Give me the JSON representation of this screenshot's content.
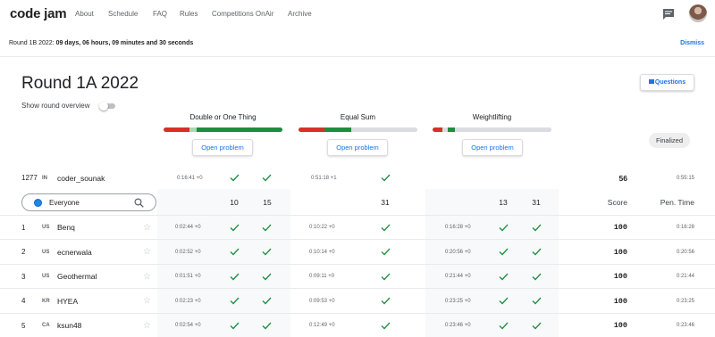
{
  "nav": {
    "logo": "code jam",
    "links": [
      "About",
      "Schedule",
      "FAQ",
      "Rules",
      "Competitions OnAir",
      "Archive"
    ],
    "icons": [
      "chat-icon",
      "avatar"
    ]
  },
  "banner": {
    "label": "Round 1B 2022:",
    "time": "09 days, 06 hours, 09 minutes and 30 seconds",
    "dismiss": "Dismiss"
  },
  "header": {
    "title": "Round 1A 2022",
    "questions_label": "Questions",
    "overview_label": "Show round overview",
    "overview_on": false
  },
  "problems": [
    {
      "name": "Double or One Thing",
      "open_label": "Open problem",
      "bar": [
        {
          "frac": 0.22,
          "color": "#d93025"
        },
        {
          "frac": 0.06,
          "color": "#a8dab5"
        },
        {
          "frac": 0.72,
          "color": "#1e8e3e"
        }
      ]
    },
    {
      "name": "Equal Sum",
      "open_label": "Open problem",
      "bar": [
        {
          "frac": 0.22,
          "color": "#d93025"
        },
        {
          "frac": 0.22,
          "color": "#1e8e3e"
        },
        {
          "frac": 0.56,
          "color": "#dadce0"
        }
      ]
    },
    {
      "name": "Weightlifting",
      "open_label": "Open problem",
      "bar": [
        {
          "frac": 0.08,
          "color": "#d93025"
        },
        {
          "frac": 0.05,
          "color": "#dadce0"
        },
        {
          "frac": 0.06,
          "color": "#1e8e3e"
        },
        {
          "frac": 0.81,
          "color": "#dadce0"
        }
      ]
    }
  ],
  "status": "Finalized",
  "my_row": {
    "rank": "1277",
    "country": "IN",
    "name": "coder_sounak",
    "t1": "0:16:41 +0",
    "t2": "0:51:18 +1",
    "c1a": true,
    "c1b": true,
    "c2": true,
    "score": "56",
    "penalty": "0:55:15"
  },
  "filter": {
    "value": "Everyone"
  },
  "table_header": {
    "p1a": "10",
    "p1b": "15",
    "p2": "31",
    "p3a": "13",
    "p3b": "31",
    "score": "Score",
    "pen_time": "Pen. Time"
  },
  "rows": [
    {
      "rank": "1",
      "country": "US",
      "name": "Benq",
      "t1": "0:02:44 +0",
      "t2": "0:10:22 +0",
      "t3": "0:16:28 +0",
      "score": "100",
      "penalty": "0:16:28"
    },
    {
      "rank": "2",
      "country": "US",
      "name": "ecnerwala",
      "t1": "0:02:52 +0",
      "t2": "0:10:14 +0",
      "t3": "0:20:56 +0",
      "score": "100",
      "penalty": "0:20:56"
    },
    {
      "rank": "3",
      "country": "US",
      "name": "Geothermal",
      "t1": "0:01:51 +0",
      "t2": "0:09:11 +0",
      "t3": "0:21:44 +0",
      "score": "100",
      "penalty": "0:21:44"
    },
    {
      "rank": "4",
      "country": "KR",
      "name": "HYEA",
      "t1": "0:02:23 +0",
      "t2": "0:09:53 +0",
      "t3": "0:23:25 +0",
      "score": "100",
      "penalty": "0:23:25"
    },
    {
      "rank": "5",
      "country": "CA",
      "name": "ksun48",
      "t1": "0:02:54 +0",
      "t2": "0:12:49 +0",
      "t3": "0:23:46 +0",
      "score": "100",
      "penalty": "0:23:46"
    }
  ]
}
